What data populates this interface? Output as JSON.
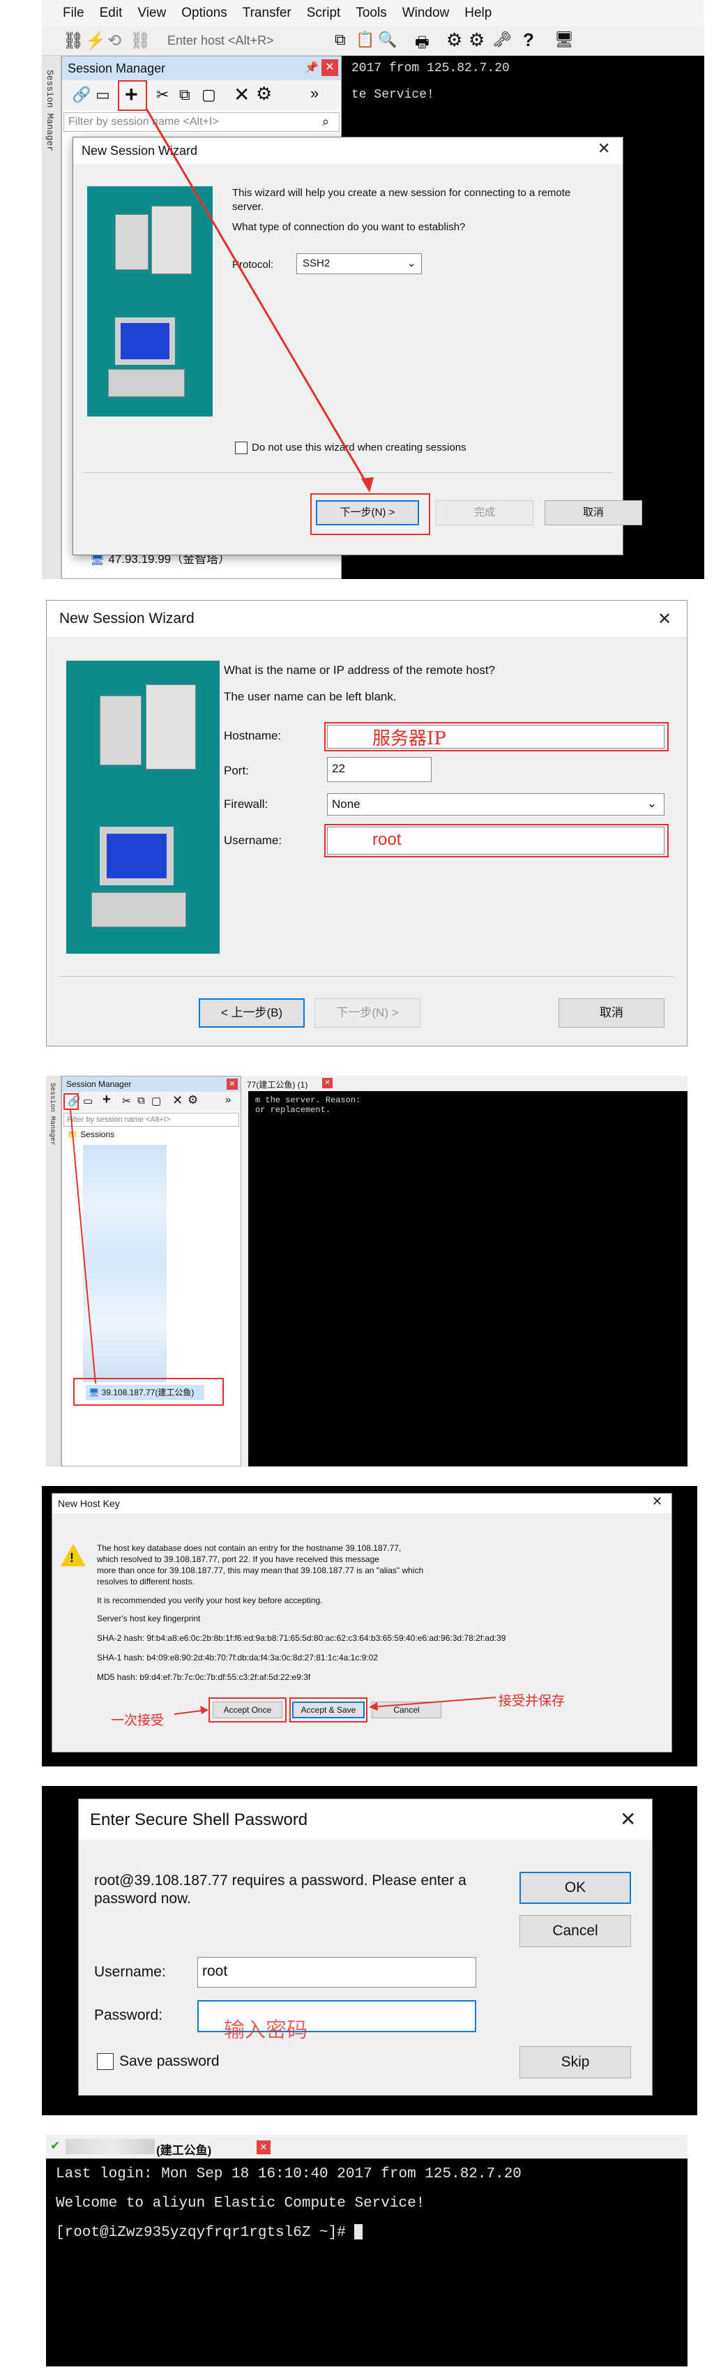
{
  "s1": {
    "menu": [
      "File",
      "Edit",
      "View",
      "Options",
      "Transfer",
      "Script",
      "Tools",
      "Window",
      "Help"
    ],
    "host_placeholder": "Enter host <Alt+R>",
    "session_manager_title": "Session Manager",
    "side_tab": "Session Manager",
    "filter_placeholder": "Filter by session name <Alt+I>",
    "terminal_lines": [
      "2017 from 125.82.7.20",
      "te Service!"
    ],
    "wizard_title": "New Session Wizard",
    "wizard_text1": "This wizard will help you create a new session for connecting to a remote server.",
    "wizard_text2": "What type of connection do you want to establish?",
    "protocol_label": "Protocol:",
    "protocol_value": "SSH2",
    "dont_use_label": "Do not use this wizard when creating sessions",
    "next_btn": "下一步(N) >",
    "finish_btn": "完成",
    "cancel_btn": "取消",
    "tree_item": "47.93.19.99（金智塔）"
  },
  "s2": {
    "title": "New Session Wizard",
    "question": "What is the name or IP address of the remote host?",
    "note": "The user name can be left blank.",
    "hostname_label": "Hostname:",
    "hostname_value": "服务器IP",
    "port_label": "Port:",
    "port_value": "22",
    "firewall_label": "Firewall:",
    "firewall_value": "None",
    "username_label": "Username:",
    "username_value": "root",
    "back_btn": "< 上一步(B)",
    "next_btn": "下一步(N) >",
    "cancel_btn": "取消"
  },
  "s3": {
    "panel_title": "Session Manager",
    "tab_title": "77(建工公鱼) (1)",
    "side_tab": "Session Manager",
    "filter_placeholder": "Filter by session name <Alt+I>",
    "sessions_label": "Sessions",
    "selected_item": "39.108.187.77(建工公鱼)",
    "terminal_lines": [
      "m the server.  Reason:",
      "  or replacement."
    ]
  },
  "s4": {
    "title": "New Host Key",
    "msg": [
      "The host key database does not contain an entry for the hostname 39.108.187.77,",
      "which resolved to 39.108.187.77, port 22.  If you have received this message",
      "more than once for 39.108.187.77, this may mean that 39.108.187.77 is an \"alias\" which",
      "resolves to different hosts."
    ],
    "recommend": "It is recommended you verify your host key before accepting.",
    "fingerprint_label": "Server's host key fingerprint",
    "sha2": "SHA-2 hash: 9f:b4:a8:e6:0c:2b:8b:1f:f6:ed:9a:b8:71:65:5d:80:ac:62:c3:64:b3:65:59:40:e6:ad:96:3d:78:2f:ad:39",
    "sha1": "SHA-1 hash: b4:09:e8:90:2d:4b:70:7f:db:da:f4:3a:0c:8d:27:81:1c:4a:1c:9:02",
    "md5": "MD5 hash: b9:d4:ef:7b:7c:0c:7b:df:55:c3:2f:af:5d:22:e9:3f",
    "accept_once_btn": "Accept Once",
    "accept_save_btn": "Accept & Save",
    "cancel_btn": "Cancel",
    "annotation_once": "一次接受",
    "annotation_save": "接受并保存"
  },
  "s5": {
    "title": "Enter Secure Shell Password",
    "message": "root@39.108.187.77 requires a password.  Please enter a password now.",
    "username_label": "Username:",
    "username_value": "root",
    "password_label": "Password:",
    "password_hint": "输入密码",
    "save_password": "Save password",
    "ok_btn": "OK",
    "cancel_btn": "Cancel",
    "skip_btn": "Skip"
  },
  "s6": {
    "tab_title": "(建工公鱼)",
    "lines": [
      "Last login: Mon Sep 18 16:10:40 2017 from 125.82.7.20",
      "Welcome to aliyun Elastic Compute Service!",
      "[root@iZwz935yzqyfrqr1rgtsl6Z ~]# "
    ]
  },
  "colors": {
    "annotation_red": "#e53030",
    "terminal_bg": "#000000",
    "accent_blue": "#0078d7",
    "dialog_bg": "#f0f0f0"
  }
}
